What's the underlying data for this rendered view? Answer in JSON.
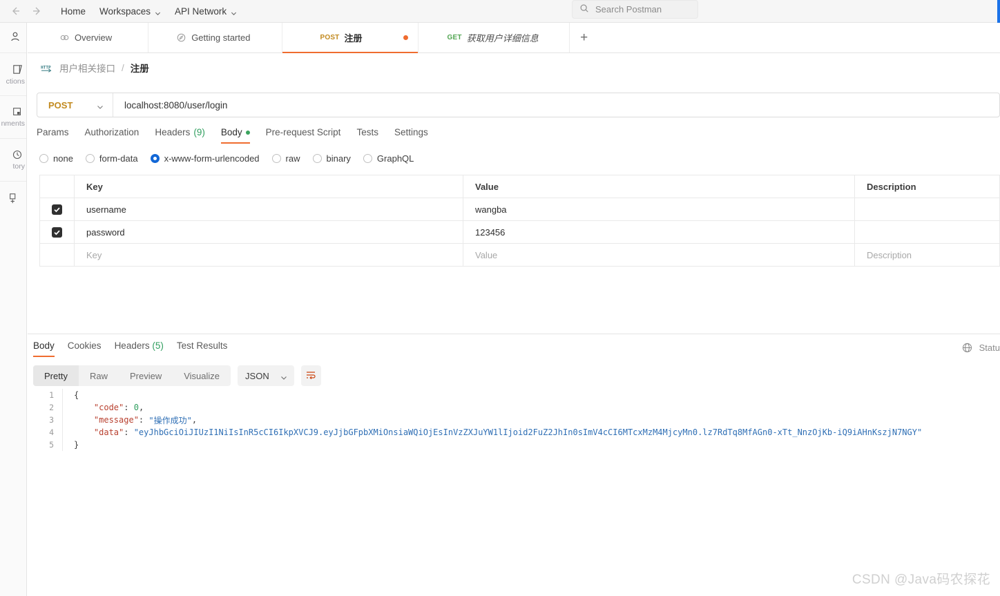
{
  "topbar": {
    "back_icon": "arrow-left-icon",
    "forward_icon": "arrow-right-icon",
    "home": "Home",
    "workspaces": "Workspaces",
    "api_network": "API Network",
    "search_placeholder": "Search Postman",
    "search_icon": "search-icon"
  },
  "rail": {
    "items": [
      {
        "icon": "person-icon",
        "label": ""
      },
      {
        "icon": "collections-icon",
        "label": "ctions"
      },
      {
        "icon": "environments-icon",
        "label": "nments"
      },
      {
        "icon": "history-icon",
        "label": "tory"
      }
    ],
    "new_icon": "new-square-plus-icon"
  },
  "tabs": [
    {
      "icon": "overview-icon",
      "method": "",
      "name": "Overview",
      "style": "plain",
      "active": false,
      "dirty": false
    },
    {
      "icon": "getting-started-icon",
      "method": "",
      "name": "Getting started",
      "style": "plain",
      "active": false,
      "dirty": false
    },
    {
      "icon": "",
      "method": "POST",
      "name": "注册",
      "style": "cn",
      "active": true,
      "dirty": true
    },
    {
      "icon": "",
      "method": "GET",
      "name": "获取用户详细信息",
      "style": "italic",
      "active": false,
      "dirty": false
    }
  ],
  "tab_add_label": "+",
  "breadcrumb": {
    "icon": "http-icon",
    "collection": "用户相关接口",
    "separator": "/",
    "request": "注册"
  },
  "urlbar": {
    "method": "POST",
    "method_caret_icon": "chevron-down-icon",
    "url": "localhost:8080/user/login"
  },
  "request_tabs": [
    {
      "label": "Params",
      "active": false
    },
    {
      "label": "Authorization",
      "active": false
    },
    {
      "label": "Headers",
      "count": "(9)",
      "active": false
    },
    {
      "label": "Body",
      "dot": true,
      "active": true
    },
    {
      "label": "Pre-request Script",
      "active": false
    },
    {
      "label": "Tests",
      "active": false
    },
    {
      "label": "Settings",
      "active": false
    }
  ],
  "body_modes": [
    {
      "label": "none",
      "selected": false
    },
    {
      "label": "form-data",
      "selected": false
    },
    {
      "label": "x-www-form-urlencoded",
      "selected": true
    },
    {
      "label": "raw",
      "selected": false
    },
    {
      "label": "binary",
      "selected": false
    },
    {
      "label": "GraphQL",
      "selected": false
    }
  ],
  "kv_table": {
    "headers": {
      "key": "Key",
      "value": "Value",
      "description": "Description"
    },
    "rows": [
      {
        "checked": true,
        "key": "username",
        "value": "wangba",
        "description": "",
        "placeholder": false
      },
      {
        "checked": true,
        "key": "password",
        "value": "123456",
        "description": "",
        "placeholder": false
      },
      {
        "checked": false,
        "key": "Key",
        "value": "Value",
        "description": "Description",
        "placeholder": true
      }
    ]
  },
  "response_tabs": [
    {
      "label": "Body",
      "active": true
    },
    {
      "label": "Cookies",
      "active": false
    },
    {
      "label": "Headers",
      "count": "(5)",
      "active": false
    },
    {
      "label": "Test Results",
      "active": false
    }
  ],
  "response_status": {
    "globe_icon": "globe-icon",
    "text": "Statu"
  },
  "view_bar": {
    "segments": [
      {
        "label": "Pretty",
        "active": true
      },
      {
        "label": "Raw",
        "active": false
      },
      {
        "label": "Preview",
        "active": false
      },
      {
        "label": "Visualize",
        "active": false
      }
    ],
    "format": "JSON",
    "format_caret_icon": "chevron-down-icon",
    "wrap_icon": "word-wrap-icon"
  },
  "response_body": {
    "lines": [
      {
        "num": "1",
        "segments": [
          {
            "t": "{",
            "c": "p"
          }
        ]
      },
      {
        "num": "2",
        "segments": [
          {
            "t": "    \"code\"",
            "c": "k"
          },
          {
            "t": ": ",
            "c": "p"
          },
          {
            "t": "0",
            "c": "n"
          },
          {
            "t": ",",
            "c": "p"
          }
        ]
      },
      {
        "num": "3",
        "segments": [
          {
            "t": "    \"message\"",
            "c": "k"
          },
          {
            "t": ": ",
            "c": "p"
          },
          {
            "t": "\"操作成功\"",
            "c": "s"
          },
          {
            "t": ",",
            "c": "p"
          }
        ]
      },
      {
        "num": "4",
        "segments": [
          {
            "t": "    \"data\"",
            "c": "k"
          },
          {
            "t": ": ",
            "c": "p"
          },
          {
            "t": "\"eyJhbGciOiJIUzI1NiIsInR5cCI6IkpXVCJ9.eyJjbGFpbXMiOnsiaWQiOjEsInVzZXJuYW1lIjoid2FuZ2JhIn0sImV4cCI6MTcxMzM4MjcyMn0.lz7RdTq8MfAGn0-xTt_NnzOjKb-iQ9iAHnKszjN7NGY\"",
            "c": "s"
          }
        ]
      },
      {
        "num": "5",
        "segments": [
          {
            "t": "}",
            "c": "p"
          }
        ]
      }
    ]
  },
  "watermark": "CSDN @Java码农探花",
  "colors": {
    "accent_orange": "#ef6c2f",
    "post_amber": "#c28a1f",
    "get_green": "#53a653",
    "radio_blue": "#1267d6",
    "string_blue": "#2f6fb5",
    "key_red": "#b8402f",
    "number_green": "#2f9e5e"
  }
}
